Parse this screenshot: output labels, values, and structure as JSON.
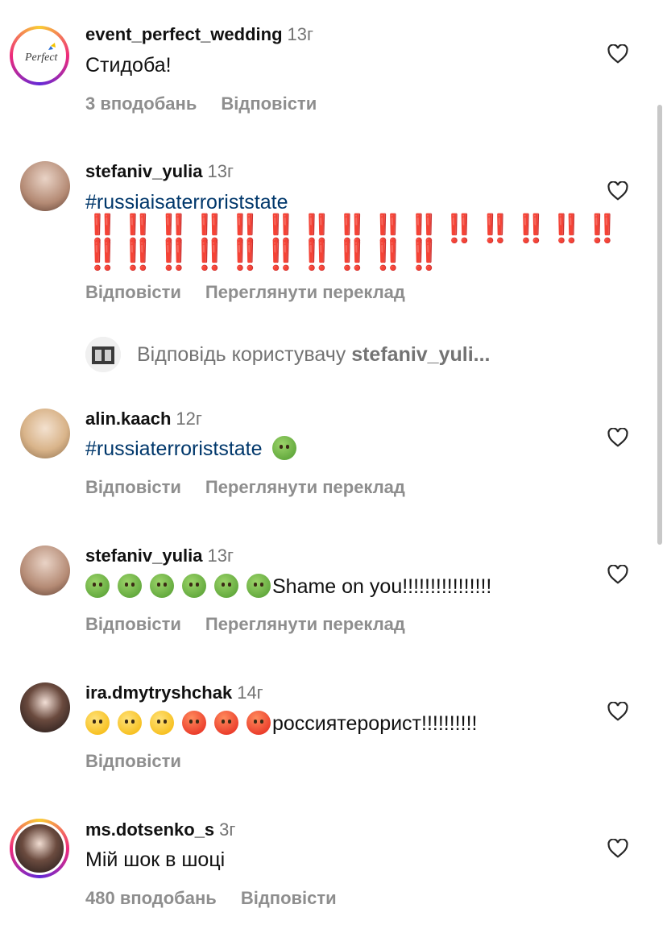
{
  "comments": [
    {
      "username": "event_perfect_wedding",
      "time": "13г",
      "text": "Стидоба!",
      "likes": "3 вподобань",
      "reply": "Відповісти"
    },
    {
      "username": "stefaniv_yulia",
      "time": "13г",
      "hashtag": "#russiaisaterroriststate",
      "bang_line1": "‼️‼️‼️‼️‼️‼️‼️‼️‼️‼️‼️‼️‼️‼️‼️",
      "bang_line2": "‼️‼️‼️‼️‼️‼️‼️‼️‼️‼️",
      "reply": "Відповісти",
      "translate": "Переглянути переклад"
    },
    {
      "username": "alin.kaach",
      "time": "12г",
      "hashtag": "#russiaterroriststate",
      "reply": "Відповісти",
      "translate": "Переглянути переклад"
    },
    {
      "username": "stefaniv_yulia",
      "time": "13г",
      "text": "Shame on you!!!!!!!!!!!!!!!!",
      "reply": "Відповісти",
      "translate": "Переглянути переклад"
    },
    {
      "username": "ira.dmytryshchak",
      "time": "14г",
      "text": "россиятерорист!!!!!!!!!!",
      "reply": "Відповісти"
    },
    {
      "username": "ms.dotsenko_s",
      "time": "3г",
      "text": "Мій шок в шоці",
      "likes": "480 вподобань",
      "reply": "Відповісти"
    }
  ],
  "thread": {
    "prefix": "Відповідь користувачу ",
    "user": "stefaniv_yuli..."
  },
  "icons": {
    "heart": "heart-outline-icon"
  },
  "colors": {
    "hashtag": "#00376b",
    "meta": "#8e8e8e",
    "alarm": "#e0221e"
  }
}
